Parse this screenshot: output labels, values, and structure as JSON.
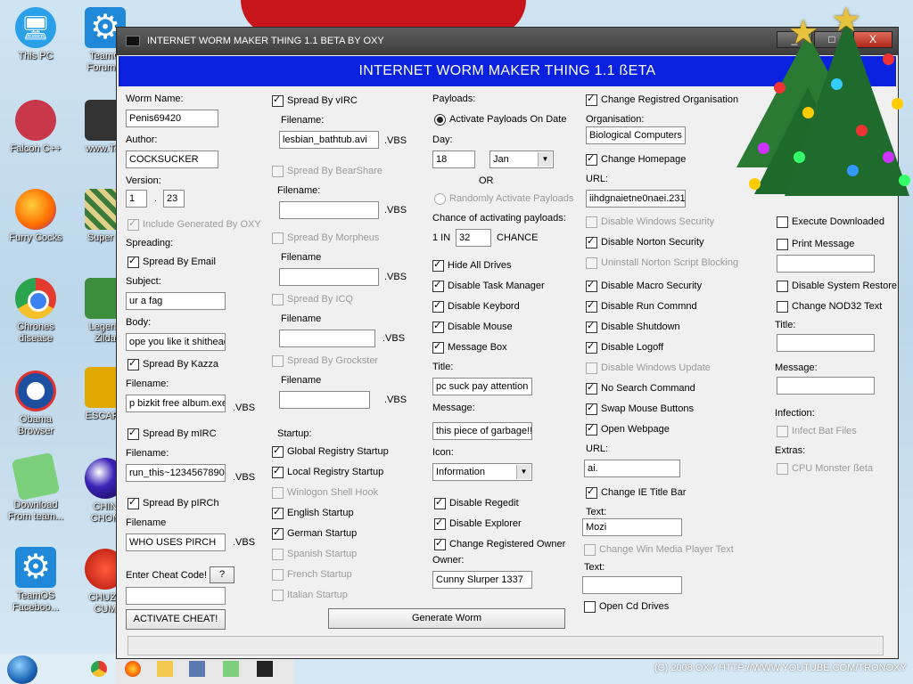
{
  "desktop": {
    "icons": [
      {
        "label": "This PC"
      },
      {
        "label": "TeamO\nForum L"
      },
      {
        "label": "Falcon C++"
      },
      {
        "label": "www.Tea"
      },
      {
        "label": "Furry Cocks"
      },
      {
        "label": "Super H"
      },
      {
        "label": "Chrones\ndisease"
      },
      {
        "label": "Legend\nZilda"
      },
      {
        "label": "Obama\nBrowser"
      },
      {
        "label": "ESCAPE"
      },
      {
        "label": "Download\nFrom team..."
      },
      {
        "label": "CHIN\nCHON"
      },
      {
        "label": "TeamOS\nFaceboo..."
      },
      {
        "label": "CHUZZ\nCUM"
      }
    ],
    "copyright": "(C) 2008 OXY HTTP://WWW.YOUTUBE.COM/TRONOXY"
  },
  "window": {
    "title": "INTERNET WORM MAKER THING 1.1 BETA BY OXY",
    "banner": "INTERNET WORM MAKER THING 1.1 ßETA",
    "min": "_",
    "max": "□",
    "close": "X"
  },
  "col1": {
    "worm_name_label": "Worm Name:",
    "worm_name": "Penis69420",
    "author_label": "Author:",
    "author": "COCKSUCKER",
    "version_label": "Version:",
    "version_major": "1",
    "version_dot": ".",
    "version_minor": "23",
    "include_oxy": "Include Generated By OXY",
    "spreading_label": "Spreading:",
    "spread_email": "Spread By Email",
    "subject_label": "Subject:",
    "subject": "ur a fag",
    "body_label": "Body:",
    "body": "ope you like it shithead",
    "spread_kazza": "Spread By Kazza",
    "kazza_filename_label": "Filename:",
    "kazza_filename": "p bizkit free album.exe",
    "kazza_ext": ".VBS",
    "spread_mirc": "Spread By mIRC",
    "mirc_filename_label": "Filename:",
    "mirc_filename": "run_this~1234567890",
    "mirc_ext": ".VBS",
    "spread_pirch": "Spread By pIRCh",
    "pirch_filename_label": "Filename",
    "pirch_filename": "WHO USES PIRCH",
    "pirch_ext": ".VBS",
    "cheat_label": "Enter Cheat Code!",
    "cheat_help": "?",
    "cheat_value": "",
    "activate_cheat": "ACTIVATE CHEAT!"
  },
  "col2": {
    "spread_virc": "Spread By vIRC",
    "virc_filename_label": "Filename:",
    "virc_filename": "lesbian_bathtub.avi",
    "virc_ext": ".VBS",
    "spread_bearshare": "Spread By BearShare",
    "bearshare_filename_label": "Filename:",
    "bearshare_ext": ".VBS",
    "spread_morpheus": "Spread By Morpheus",
    "morpheus_filename_label": "Filename",
    "morpheus_ext": ".VBS",
    "spread_icq": "Spread By ICQ",
    "icq_filename_label": "Filename",
    "icq_ext": ".VBS",
    "spread_grockster": "Spread By Grockster",
    "grockster_filename_label": "Filename",
    "grockster_ext": ".VBS",
    "startup_label": "Startup:",
    "global_registry": "Global Registry Startup",
    "local_registry": "Local Registry Startup",
    "winlogon": "Winlogon Shell Hook",
    "english": "English Startup",
    "german": "German Startup",
    "spanish": "Spanish Startup",
    "french": "French Startup",
    "italian": "Italian Startup",
    "generate": "Generate Worm"
  },
  "col3": {
    "payloads_label": "Payloads:",
    "activate_on_date": "Activate Payloads On Date",
    "day_label": "Day:",
    "day": "18",
    "month": "Jan",
    "or_label": "OR",
    "randomly_activate": "Randomly Activate Payloads",
    "chance_label": "Chance of activating payloads:",
    "one_in": "1 IN",
    "chance_value": "32",
    "chance_word": "CHANCE",
    "hide_drives": "Hide All Drives",
    "disable_task_manager": "Disable Task Manager",
    "disable_keyboard": "Disable Keybord",
    "disable_mouse": "Disable Mouse",
    "message_box": "Message Box",
    "title_label": "Title:",
    "title_value": "pc suck pay attention",
    "message_label": "Message:",
    "message_value": "this piece of garbage!!",
    "icon_label": "Icon:",
    "icon_value": "Information",
    "disable_regedit": "Disable Regedit",
    "disable_explorer": "Disable Explorer",
    "change_owner": "Change Registered Owner",
    "owner_label": "Owner:",
    "owner_value": "Cunny Slurper 1337"
  },
  "col4": {
    "change_org": "Change Registred Organisation",
    "org_label": "Organisation:",
    "org_value": "Biological Computers",
    "change_homepage": "Change Homepage",
    "url_label": "URL:",
    "url_value": "iihdgnaietne0naei.231",
    "disable_win_security": "Disable Windows Security",
    "disable_norton": "Disable Norton Security",
    "uninstall_norton": "Uninstall Norton Script Blocking",
    "disable_macro": "Disable Macro Security",
    "disable_run": "Disable Run Commnd",
    "disable_shutdown": "Disable Shutdown",
    "disable_logoff": "Disable Logoff",
    "disable_win_update": "Disable Windows Update",
    "no_search": "No Search Command",
    "swap_mouse": "Swap Mouse Buttons",
    "open_webpage": "Open Webpage",
    "url2_label": "URL:",
    "url2_value": "ai.",
    "change_ie_title": "Change IE Title Bar",
    "text_label": "Text:",
    "text_value": "Mozi",
    "change_wmp_text": "Change Win Media Player Text",
    "text2_label": "Text:",
    "open_cd": "Open Cd Drives"
  },
  "col5": {
    "execute_downloaded": "Execute Downloaded",
    "print_message": "Print Message",
    "disable_restore": "Disable System Restore",
    "change_nod32": "Change NOD32 Text",
    "title_label": "Title:",
    "message_label": "Message:",
    "infection_label": "Infection:",
    "infect_bat": "Infect Bat Files",
    "extras_label": "Extras:",
    "cpu_monster": "CPU Monster ßeta"
  },
  "colors": {
    "banner": "#0a22e0",
    "titlebar": "#4a4a4a"
  }
}
